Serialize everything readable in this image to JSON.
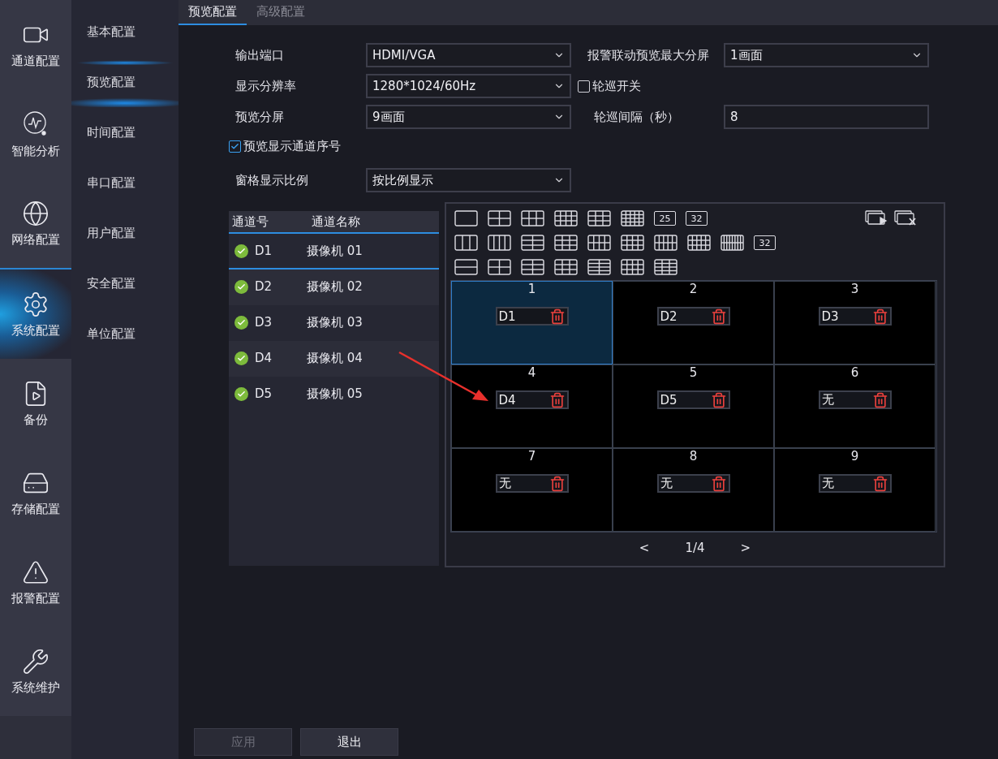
{
  "nav": [
    {
      "label": "通道配置",
      "selected": false
    },
    {
      "label": "智能分析",
      "selected": false
    },
    {
      "label": "网络配置",
      "selected": false
    },
    {
      "label": "系统配置",
      "selected": true
    },
    {
      "label": "备份",
      "selected": false
    },
    {
      "label": "存储配置",
      "selected": false
    },
    {
      "label": "报警配置",
      "selected": false
    },
    {
      "label": "系统维护",
      "selected": false
    }
  ],
  "subnav": [
    {
      "label": "基本配置",
      "selected": false
    },
    {
      "label": "预览配置",
      "selected": true
    },
    {
      "label": "时间配置",
      "selected": false
    },
    {
      "label": "串口配置",
      "selected": false
    },
    {
      "label": "用户配置",
      "selected": false
    },
    {
      "label": "安全配置",
      "selected": false
    },
    {
      "label": "单位配置",
      "selected": false
    }
  ],
  "tabs": [
    {
      "label": "预览配置",
      "selected": true
    },
    {
      "label": "高级配置",
      "selected": false
    }
  ],
  "form": {
    "output_port": {
      "label": "输出端口",
      "value": "HDMI/VGA"
    },
    "alarm_max_split": {
      "label": "报警联动预览最大分屏",
      "value": "1画面"
    },
    "resolution": {
      "label": "显示分辨率",
      "value": "1280*1024/60Hz"
    },
    "patrol_switch": {
      "label": "轮巡开关",
      "checked": false
    },
    "preview_split": {
      "label": "预览分屏",
      "value": "9画面"
    },
    "patrol_interval": {
      "label": "轮巡间隔（秒）",
      "value": "8"
    },
    "show_channel_number": {
      "label": "预览显示通道序号",
      "checked": true
    },
    "aspect_ratio": {
      "label": "窗格显示比例",
      "value": "按比例显示"
    }
  },
  "channel_table": {
    "columns": [
      "通道号",
      "通道名称"
    ],
    "rows": [
      {
        "id": "D1",
        "name": "摄像机 01",
        "selected": true
      },
      {
        "id": "D2",
        "name": "摄像机 02",
        "selected": false
      },
      {
        "id": "D3",
        "name": "摄像机 03",
        "selected": false
      },
      {
        "id": "D4",
        "name": "摄像机 04",
        "selected": false
      },
      {
        "id": "D5",
        "name": "摄像机 05",
        "selected": false
      }
    ]
  },
  "layout_buttons": [
    [
      {
        "kind": "split"
      },
      {
        "kind": "split"
      },
      {
        "kind": "split"
      },
      {
        "kind": "split"
      },
      {
        "kind": "split"
      },
      {
        "kind": "split"
      },
      {
        "kind": "numbered",
        "label": "25"
      },
      {
        "kind": "numbered",
        "label": "32"
      }
    ],
    [
      {
        "kind": "split"
      },
      {
        "kind": "split"
      },
      {
        "kind": "split"
      },
      {
        "kind": "split"
      },
      {
        "kind": "split"
      },
      {
        "kind": "split"
      },
      {
        "kind": "split"
      },
      {
        "kind": "split"
      },
      {
        "kind": "split"
      },
      {
        "kind": "numbered",
        "label": "32"
      }
    ],
    [
      {
        "kind": "split"
      },
      {
        "kind": "split"
      },
      {
        "kind": "split"
      },
      {
        "kind": "split"
      },
      {
        "kind": "split"
      },
      {
        "kind": "split"
      },
      {
        "kind": "split"
      }
    ]
  ],
  "panes": [
    {
      "number": "1",
      "channel": "D1",
      "selected": true
    },
    {
      "number": "2",
      "channel": "D2",
      "selected": false
    },
    {
      "number": "3",
      "channel": "D3",
      "selected": false
    },
    {
      "number": "4",
      "channel": "D4",
      "selected": false
    },
    {
      "number": "5",
      "channel": "D5",
      "selected": false
    },
    {
      "number": "6",
      "channel": "无",
      "selected": false
    },
    {
      "number": "7",
      "channel": "无",
      "selected": false
    },
    {
      "number": "8",
      "channel": "无",
      "selected": false
    },
    {
      "number": "9",
      "channel": "无",
      "selected": false
    }
  ],
  "pager": {
    "prev": "<",
    "page": "1/4",
    "next": ">"
  },
  "buttons": [
    {
      "label": "应用",
      "disabled": true
    },
    {
      "label": "退出",
      "disabled": false
    }
  ]
}
